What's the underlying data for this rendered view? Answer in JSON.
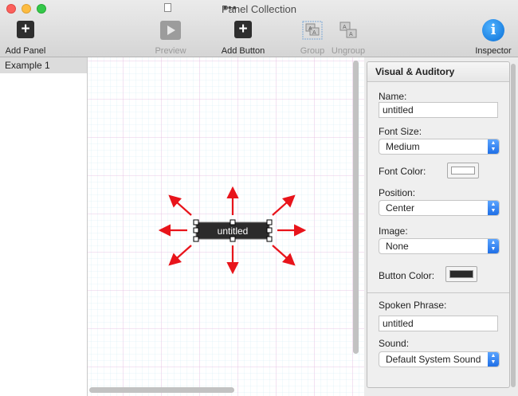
{
  "window": {
    "title": "Panel Collection",
    "more": "•••"
  },
  "toolbar": {
    "add_panel": "Add Panel",
    "preview": "Preview",
    "add_button": "Add Button",
    "group": "Group",
    "ungroup": "Ungroup",
    "inspector": "Inspector",
    "plus_glyph": "+",
    "info_glyph": "i"
  },
  "sidebar": {
    "items": [
      {
        "label": "Example 1"
      }
    ]
  },
  "canvas": {
    "button_label": "untitled"
  },
  "inspector": {
    "section_title": "Visual & Auditory",
    "name_label": "Name:",
    "name_value": "untitled",
    "font_size_label": "Font Size:",
    "font_size_value": "Medium",
    "font_color_label": "Font Color:",
    "font_color": "#ffffff",
    "position_label": "Position:",
    "position_value": "Center",
    "image_label": "Image:",
    "image_value": "None",
    "button_color_label": "Button Color:",
    "button_color": "#2b2b2b",
    "spoken_phrase_label": "Spoken Phrase:",
    "spoken_phrase_value": "untitled",
    "sound_label": "Sound:",
    "sound_value": "Default System Sound"
  },
  "colors": {
    "arrow": "#e8141b",
    "grid_major": "#e7b9e0",
    "grid_minor": "#d3ecf3"
  }
}
